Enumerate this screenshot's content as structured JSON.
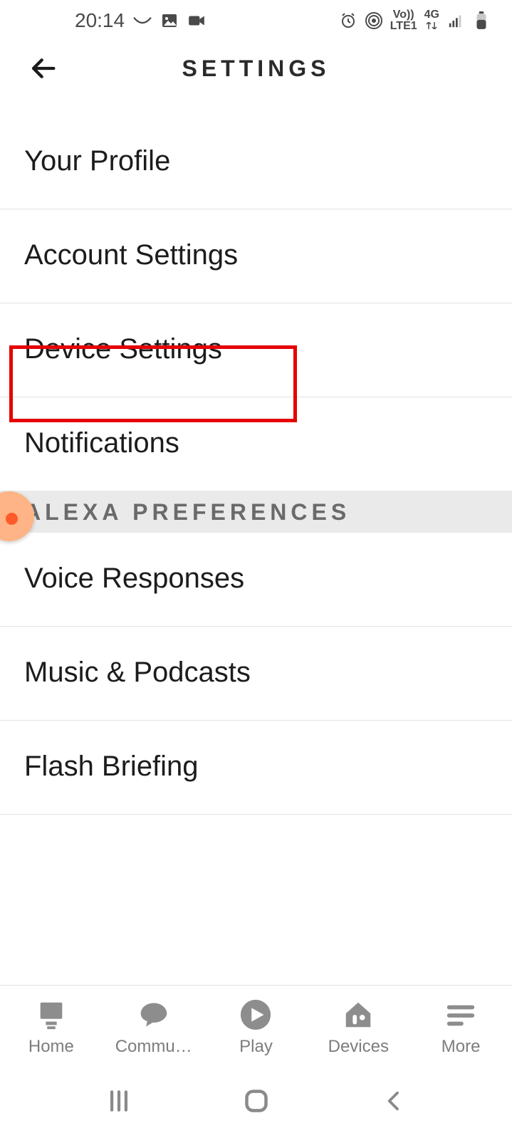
{
  "status": {
    "time": "20:14",
    "network_label_top": "Vo))",
    "network_label_bottom": "LTE1",
    "net_gen": "4G"
  },
  "header": {
    "title": "SETTINGS"
  },
  "settings": {
    "items": [
      {
        "label": "Your Profile"
      },
      {
        "label": "Account Settings"
      },
      {
        "label": "Device Settings"
      },
      {
        "label": "Notifications"
      }
    ]
  },
  "alexa_prefs": {
    "section_title": "ALEXA PREFERENCES",
    "items": [
      {
        "label": "Voice Responses"
      },
      {
        "label": "Music & Podcasts"
      },
      {
        "label": "Flash Briefing"
      }
    ]
  },
  "bottom_nav": {
    "items": [
      {
        "label": "Home"
      },
      {
        "label": "Commu…"
      },
      {
        "label": "Play"
      },
      {
        "label": "Devices"
      },
      {
        "label": "More"
      }
    ]
  },
  "highlight": {
    "target": "Device Settings"
  }
}
